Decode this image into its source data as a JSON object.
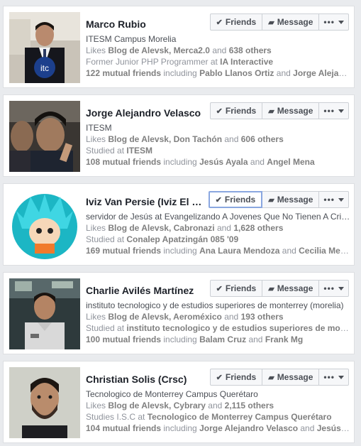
{
  "buttons": {
    "friends_label": "Friends",
    "message_label": "Message"
  },
  "cards": [
    {
      "name": "Marco Rubio",
      "subtitle": "ITESM Campus Morelia",
      "likes_prefix": "Likes ",
      "likes_pages": "Blog de Alevsk, Merca2.0",
      "likes_and": " and ",
      "likes_others": "638 others",
      "work_prefix": "Former Junior PHP Programmer at ",
      "work_place": "IA Interactive",
      "mutual_count": "122 mutual friends",
      "mutual_including": " including ",
      "mutual_names": "Pablo Llanos Ortiz",
      "mutual_and": " and ",
      "mutual_names2": "Jorge Alejandro Velasco",
      "friends_focused": false
    },
    {
      "name": "Jorge Alejandro Velasco",
      "subtitle": "ITESM",
      "likes_prefix": "Likes ",
      "likes_pages": "Blog de Alevsk, Don Tachón",
      "likes_and": " and ",
      "likes_others": "606 others",
      "work_prefix": "Studied at ",
      "work_place": "ITESM",
      "mutual_count": "108 mutual friends",
      "mutual_including": " including ",
      "mutual_names": "Jesús Ayala",
      "mutual_and": " and ",
      "mutual_names2": "Angel Mena",
      "friends_focused": false
    },
    {
      "name": "Iviz Van Persie (Iviz El Guardián)",
      "subtitle": "servidor de Jesús at Evangelizando A Jovenes Que No Tienen A Cristo",
      "likes_prefix": "Likes ",
      "likes_pages": "Blog de Alevsk, Cabronazi",
      "likes_and": " and ",
      "likes_others": "1,628 others",
      "work_prefix": "Studied at ",
      "work_place": "Conalep Apatzingán 085 '09",
      "mutual_count": "169 mutual friends",
      "mutual_including": " including ",
      "mutual_names": "Ana Laura Mendoza",
      "mutual_and": " and ",
      "mutual_names2": "Cecilia Mendoza",
      "friends_focused": true
    },
    {
      "name": "Charlie Avilés Martínez",
      "subtitle": "instituto tecnologico y de estudios superiores de monterrey (morelia)",
      "likes_prefix": "Likes ",
      "likes_pages": "Blog de Alevsk, Aeroméxico",
      "likes_and": " and ",
      "likes_others": "193 others",
      "work_prefix": "Studied at ",
      "work_place": "instituto tecnologico y de estudios superiores de monterrey",
      "mutual_count": "100 mutual friends",
      "mutual_including": " including ",
      "mutual_names": "Balam Cruz",
      "mutual_and": " and ",
      "mutual_names2": "Frank Mg",
      "friends_focused": false
    },
    {
      "name": "Christian Solis (Crsc)",
      "subtitle": "Tecnologico de Monterrey Campus Querétaro",
      "likes_prefix": "Likes ",
      "likes_pages": "Blog de Alevsk, Cybrary",
      "likes_and": " and ",
      "likes_others": "2,115 others",
      "work_prefix": "Studies I.S.C at ",
      "work_place": "Tecnologico de Monterrey Campus Querétaro",
      "mutual_count": "104 mutual friends",
      "mutual_including": " including ",
      "mutual_names": "Jorge Alejandro Velasco",
      "mutual_and": " and ",
      "mutual_names2": "Jesús Ayala",
      "friends_focused": false
    }
  ],
  "avatar_logo_text": "itc",
  "colors": {
    "name": "#1d2129",
    "meta": "#90949c",
    "button_bg": "#f6f7f9",
    "focus_border": "#8aa7e0"
  },
  "icons": [
    "checkmark-icon",
    "message-icon",
    "more-dots-icon",
    "caret-down-icon"
  ]
}
